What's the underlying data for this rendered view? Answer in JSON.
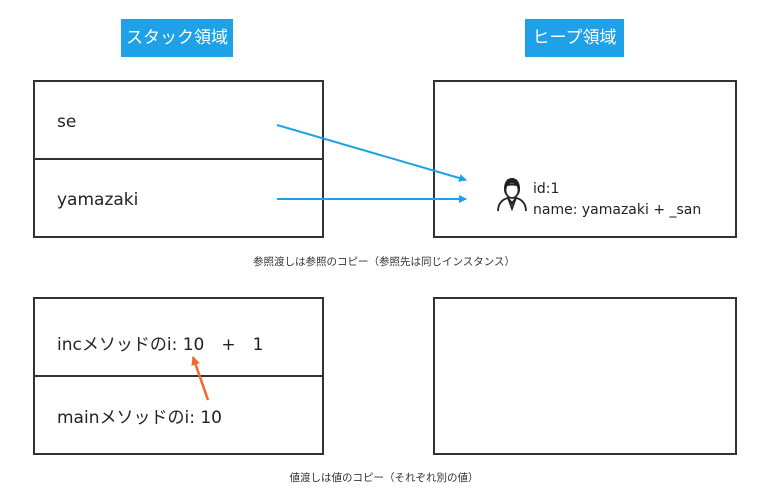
{
  "headers": {
    "stack": "スタック領域",
    "heap": "ヒープ領域"
  },
  "reference_example": {
    "stack_cells": [
      "se",
      "yamazaki"
    ],
    "heap_object": {
      "id_label": "id:1",
      "name_label": "name: yamazaki + _san"
    },
    "caption": "参照渡しは参照のコピー（参照先は同じインスタンス）"
  },
  "value_example": {
    "stack_cells": [
      "incメソッドのi: 10　+　1",
      "mainメソッドのi: 10"
    ],
    "caption": "値渡しは値のコピー（それぞれ別の値）"
  },
  "colors": {
    "header_bg": "#1ea1e6",
    "reference_arrow": "#1ea1e6",
    "value_arrow": "#f06a2a",
    "border": "#333333"
  },
  "icons": {
    "person": "person-icon"
  }
}
